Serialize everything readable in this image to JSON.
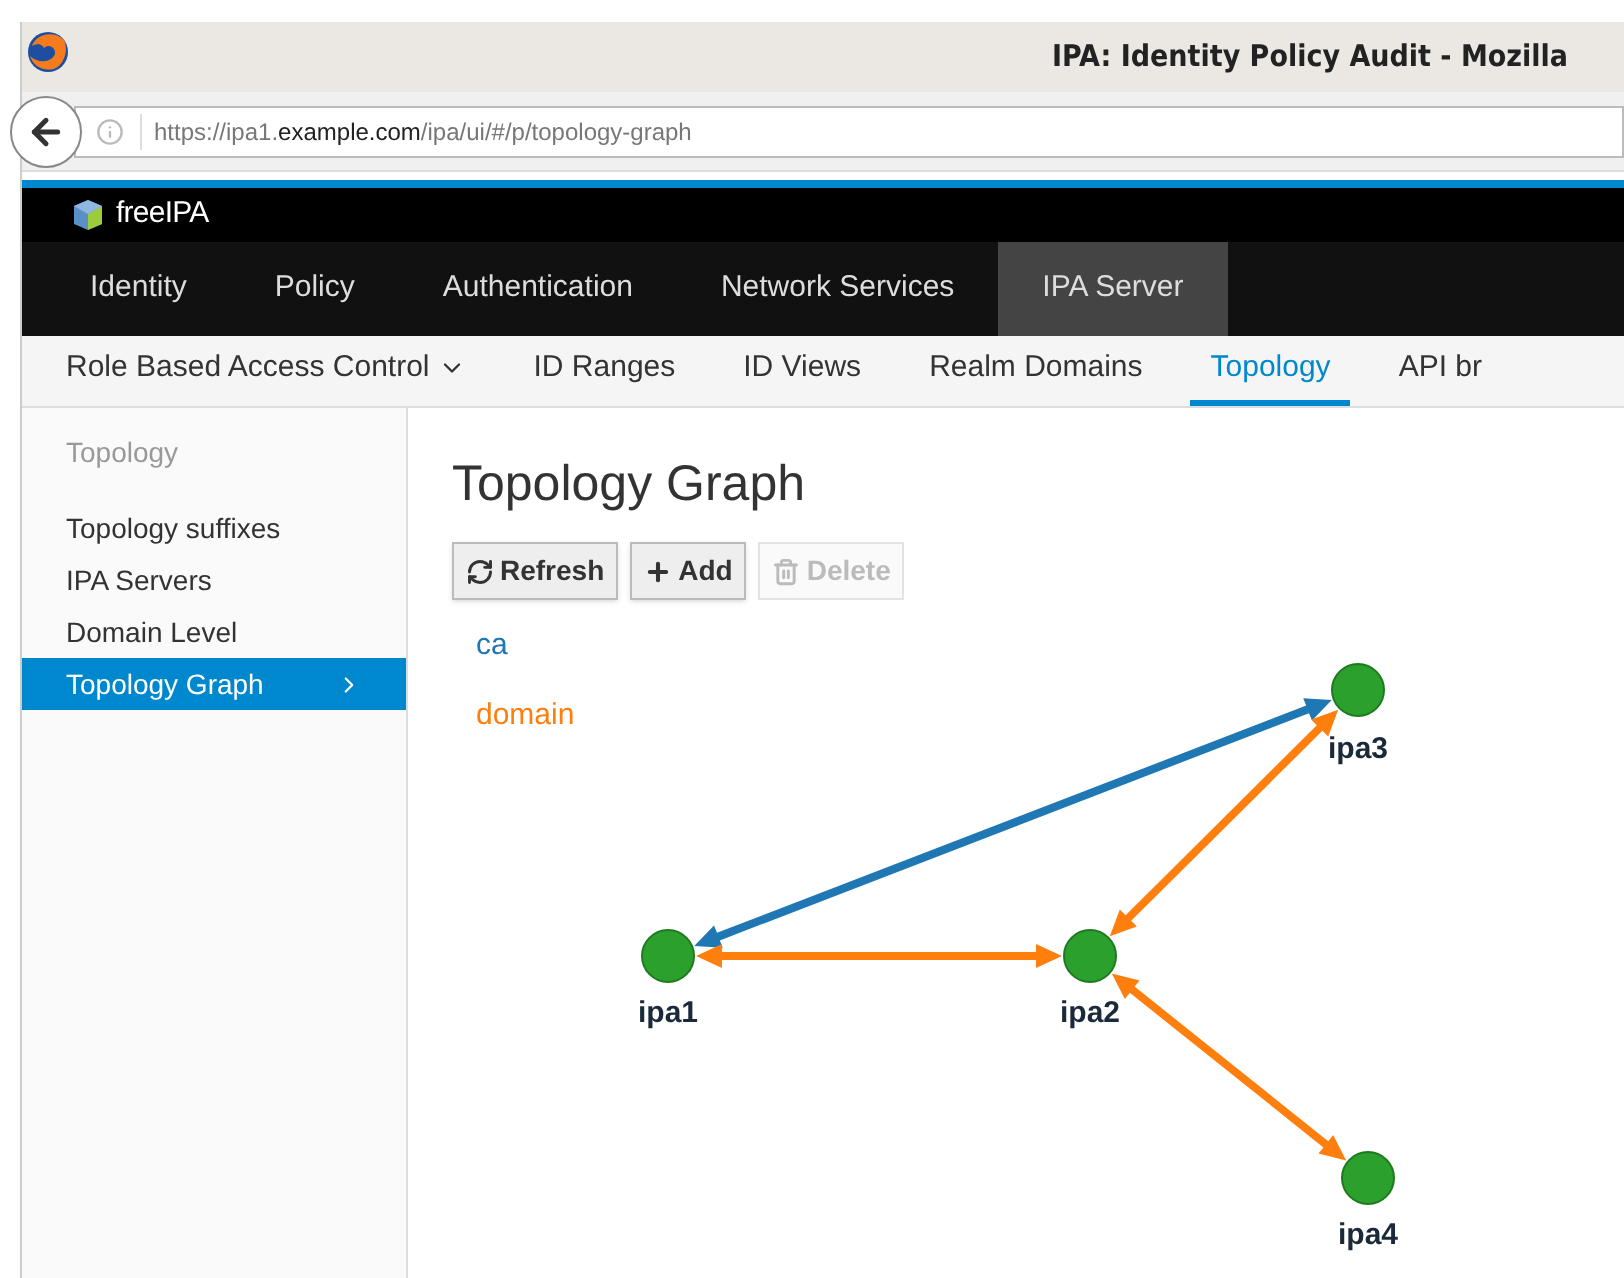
{
  "browser": {
    "title": "IPA: Identity Policy Audit - Mozilla",
    "url": "https://ipa1.**example.com**/ipa/ui/#/p/topology-graph"
  },
  "brand": "freeIPA",
  "menu": [
    {
      "label": "Identity",
      "selected": false
    },
    {
      "label": "Policy",
      "selected": false
    },
    {
      "label": "Authentication",
      "selected": false
    },
    {
      "label": "Network Services",
      "selected": false
    },
    {
      "label": "IPA Server",
      "selected": true
    }
  ],
  "submenu": [
    {
      "label": "Role Based Access Control",
      "dropdown": true,
      "selected": false
    },
    {
      "label": "ID Ranges",
      "dropdown": false,
      "selected": false
    },
    {
      "label": "ID Views",
      "dropdown": false,
      "selected": false
    },
    {
      "label": "Realm Domains",
      "dropdown": false,
      "selected": false
    },
    {
      "label": "Topology",
      "dropdown": false,
      "selected": true
    },
    {
      "label": "API br",
      "dropdown": false,
      "selected": false
    }
  ],
  "sidebar": {
    "heading": "Topology",
    "items": [
      {
        "label": "Topology suffixes",
        "selected": false
      },
      {
        "label": "IPA Servers",
        "selected": false
      },
      {
        "label": "Domain Level",
        "selected": false
      },
      {
        "label": "Topology Graph",
        "selected": true
      }
    ]
  },
  "page_title": "Topology Graph",
  "toolbar": [
    {
      "kind": "refresh",
      "label": "Refresh",
      "disabled": false
    },
    {
      "kind": "add",
      "label": "Add",
      "disabled": false
    },
    {
      "kind": "delete",
      "label": "Delete",
      "disabled": true
    }
  ],
  "legend": [
    {
      "label": "ca",
      "color": "#1f77b4"
    },
    {
      "label": "domain",
      "color": "#ff7f0e"
    }
  ],
  "graph": {
    "nodes": [
      {
        "label": "ipa1"
      },
      {
        "label": "ipa2"
      },
      {
        "label": "ipa3"
      },
      {
        "label": "ipa4"
      }
    ],
    "edges": [
      {
        "color": "#1f77b4"
      },
      {
        "color": "#ff7f0e"
      },
      {
        "color": "#ff7f0e"
      },
      {
        "color": "#ff7f0e"
      }
    ]
  }
}
